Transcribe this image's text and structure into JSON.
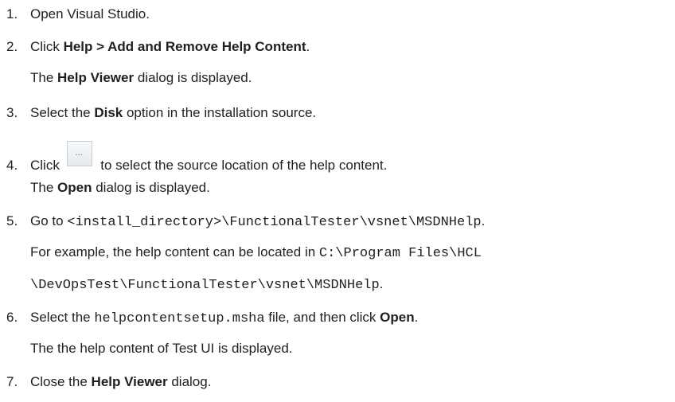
{
  "steps": {
    "s1": {
      "num": "1.",
      "text": "Open Visual Studio."
    },
    "s2": {
      "num": "2.",
      "pre": "Click ",
      "bold": "Help > Add and Remove Help Content",
      "post": ".",
      "note_pre": "The ",
      "note_bold": "Help Viewer",
      "note_post": " dialog is displayed."
    },
    "s3": {
      "num": "3.",
      "pre": "Select the ",
      "bold": "Disk",
      "post": " option in the installation source."
    },
    "s4": {
      "num": "4.",
      "pre": "Click ",
      "button_glyph": "…",
      "post": " to select the source location of the help content.",
      "note_pre": "The ",
      "note_bold": "Open",
      "note_post": " dialog is displayed."
    },
    "s5": {
      "num": "5.",
      "pre": "Go to ",
      "code": "<install_directory>\\FunctionalTester\\vsnet\\MSDNHelp",
      "post": ".",
      "example_pre": "For example, the help content can be located in ",
      "example_code_1": "C:\\Program Files\\HCL",
      "example_code_2": "\\DevOpsTest\\FunctionalTester\\vsnet\\MSDNHelp",
      "example_post": "."
    },
    "s6": {
      "num": "6.",
      "pre": "Select the ",
      "code": "helpcontentsetup.msha",
      "mid": " file, and then click ",
      "bold": "Open",
      "post": ".",
      "note": "The the help content of Test UI is displayed."
    },
    "s7": {
      "num": "7.",
      "pre": "Close the ",
      "bold": "Help Viewer",
      "post": " dialog."
    }
  }
}
